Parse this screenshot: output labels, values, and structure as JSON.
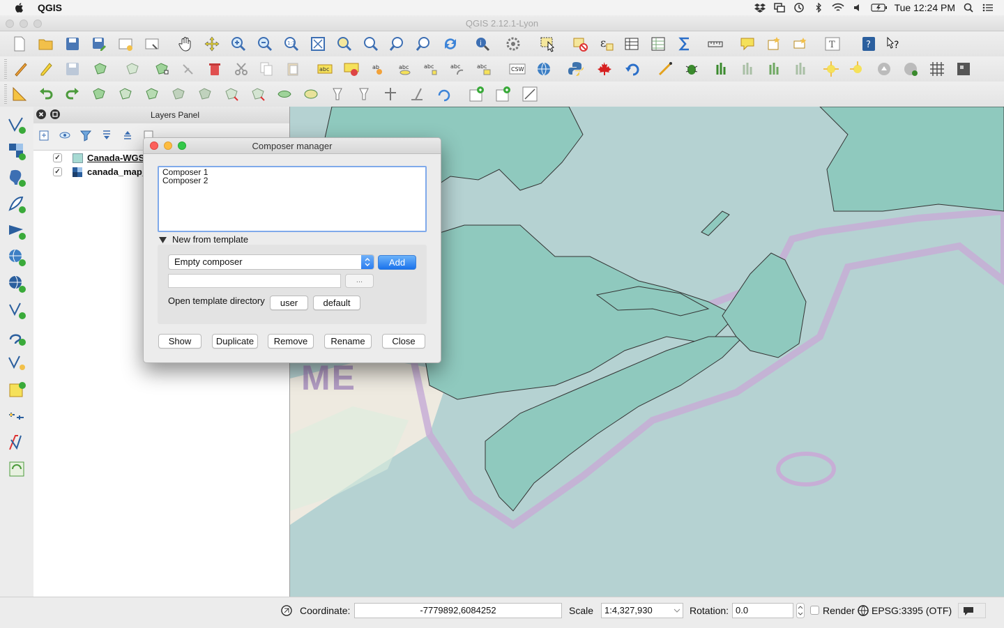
{
  "menubar": {
    "app_name": "QGIS",
    "clock": "Tue 12:24 PM"
  },
  "window": {
    "title": "QGIS 2.12.1-Lyon"
  },
  "layers_panel": {
    "title": "Layers Panel",
    "layers": [
      {
        "name": "Canada-WGS",
        "checked": true
      },
      {
        "name": "canada_map_",
        "checked": true
      }
    ]
  },
  "map": {
    "label": "ME"
  },
  "status_bar": {
    "coordinate_label": "Coordinate:",
    "coordinate_value": "-7779892,6084252",
    "scale_label": "Scale",
    "scale_value": "1:4,327,930",
    "rotation_label": "Rotation:",
    "rotation_value": "0.0",
    "render_label": "Render",
    "crs_label": "EPSG:3395 (OTF)"
  },
  "dialog": {
    "title": "Composer manager",
    "composers": [
      "Composer 1",
      "Composer 2"
    ],
    "template_section_label": "New from template",
    "template_selected": "Empty composer",
    "add_label": "Add",
    "browse_label": "...",
    "template_dir_label": "Open template directory",
    "user_label": "user",
    "default_label": "default",
    "buttons": {
      "show": "Show",
      "duplicate": "Duplicate",
      "remove": "Remove",
      "rename": "Rename",
      "close": "Close"
    }
  },
  "colors": {
    "land": "#8fc9be",
    "sea": "#b5d2d2",
    "coast_buffer": "#c2a8cf",
    "accent_blue": "#2b7df0"
  }
}
